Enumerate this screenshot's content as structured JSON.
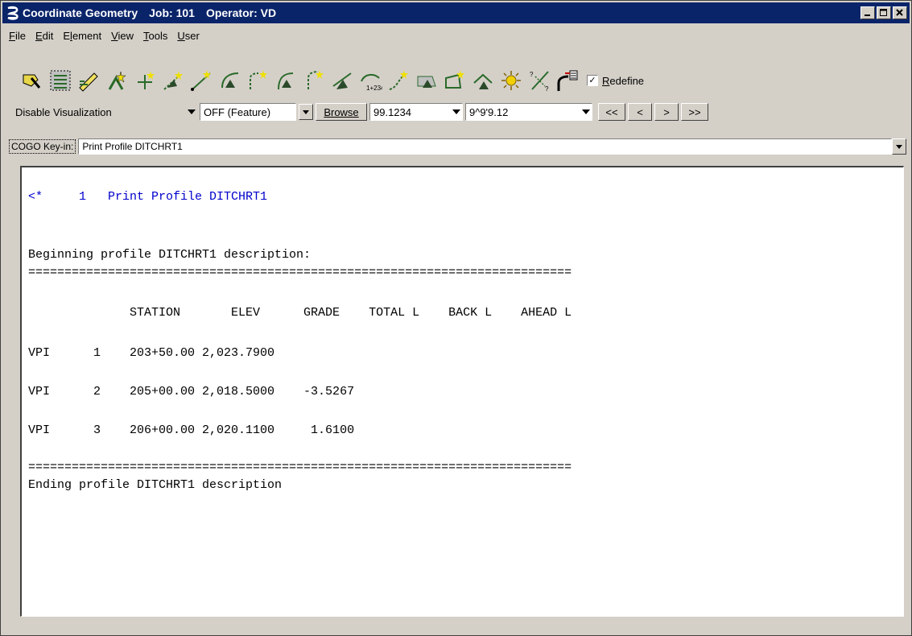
{
  "window": {
    "title_app": "Coordinate Geometry",
    "title_job": "Job: 101",
    "title_operator": "Operator: VD",
    "controls": {
      "minimize": "_",
      "maximize": "□",
      "close": "✕"
    }
  },
  "menu": {
    "items": [
      {
        "pre": "",
        "ul": "F",
        "post": "ile"
      },
      {
        "pre": "",
        "ul": "E",
        "post": "dit"
      },
      {
        "pre": "E",
        "ul": "l",
        "post": "ement"
      },
      {
        "pre": "",
        "ul": "V",
        "post": "iew"
      },
      {
        "pre": "",
        "ul": "T",
        "post": "ools"
      },
      {
        "pre": "",
        "ul": "U",
        "post": "ser"
      }
    ]
  },
  "toolbar": {
    "icons": [
      "select-point-icon",
      "list-icon",
      "edit-pencil-icon",
      "star-point-icon",
      "add-point-icon",
      "store-line-icon",
      "line-icon",
      "curve-icon",
      "curve-point-icon",
      "arc-icon",
      "arc-point-icon",
      "spiral-icon",
      "station-alignment-icon",
      "alignment-icon",
      "parcel-icon",
      "boundary-icon",
      "roof-icon",
      "sun-icon",
      "intersect-icon",
      "import-icon"
    ],
    "redefine_label_ul": "R",
    "redefine_label_rest": "edefine",
    "redefine_checked": "✓"
  },
  "controls": {
    "visualization": "Disable Visualization",
    "feature": "OFF (Feature)",
    "browse": "Browse",
    "distance": "99.1234",
    "angle": "9^9'9.12",
    "nav_first": "<<",
    "nav_prev": "<",
    "nav_next": ">",
    "nav_last": ">>"
  },
  "keyin": {
    "label": "COGO Key-in:",
    "value": "Print Profile DITCHRT1"
  },
  "output": {
    "command": "<*     1   Print Profile DITCHRT1",
    "begin": "Beginning profile DITCHRT1 description:",
    "rule": "===========================================================================",
    "header": "              STATION       ELEV      GRADE    TOTAL L    BACK L    AHEAD L",
    "rows": [
      "VPI      1    203+50.00 2,023.7900",
      "VPI      2    205+00.00 2,018.5000    -3.5267",
      "VPI      3    206+00.00 2,020.1100     1.6100"
    ],
    "end": "Ending profile DITCHRT1 description"
  }
}
